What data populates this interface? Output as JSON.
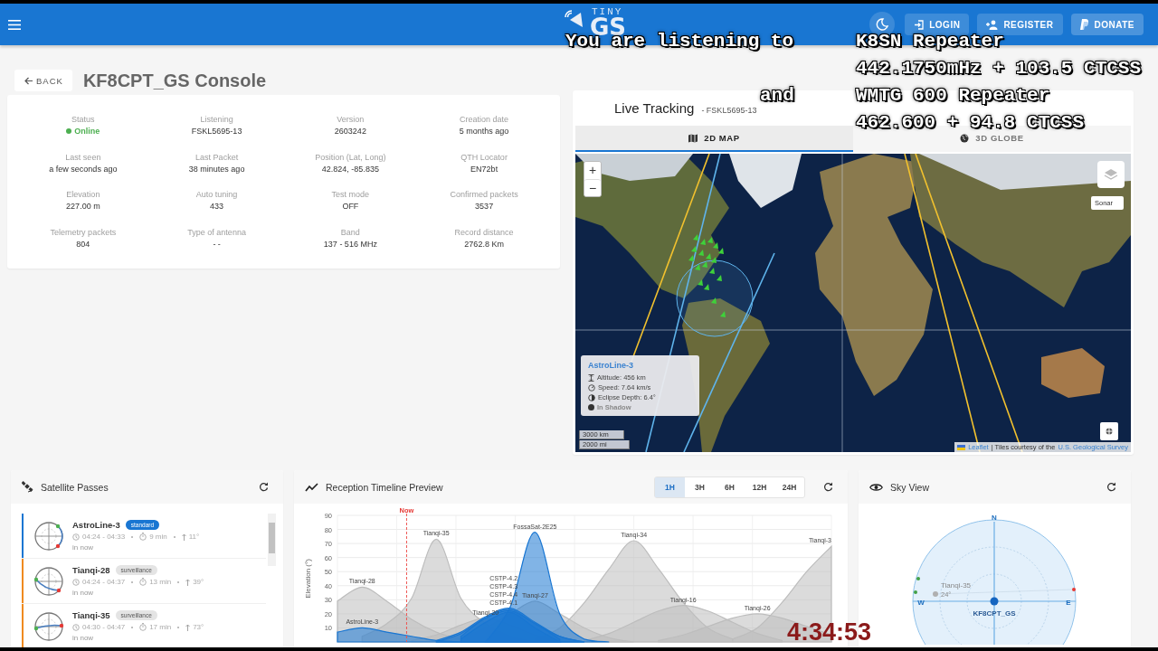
{
  "app_bar": {
    "logo_small": "TINY",
    "logo_large": "GS",
    "buttons": [
      {
        "label": "LOGIN",
        "kind": "login"
      },
      {
        "label": "REGISTER",
        "kind": "register"
      },
      {
        "label": "DONATE",
        "kind": "donate"
      }
    ]
  },
  "page": {
    "back": "BACK",
    "title": "KF8CPT_GS Console"
  },
  "station_info": [
    {
      "label": "Status",
      "value": "Online",
      "online": true
    },
    {
      "label": "Listening",
      "value": "FSKL5695-13"
    },
    {
      "label": "Version",
      "value": "2603242"
    },
    {
      "label": "Creation date",
      "value": "5 months ago"
    },
    {
      "label": "Last seen",
      "value": "a few seconds ago"
    },
    {
      "label": "Last Packet",
      "value": "38 minutes ago"
    },
    {
      "label": "Position (Lat, Long)",
      "value": "42.824, -85.835"
    },
    {
      "label": "QTH Locator",
      "value": "EN72bt"
    },
    {
      "label": "Elevation",
      "value": "227.00 m"
    },
    {
      "label": "Auto tuning",
      "value": "433"
    },
    {
      "label": "Test mode",
      "value": "OFF"
    },
    {
      "label": "Confirmed packets",
      "value": "3537"
    },
    {
      "label": "Telemetry packets",
      "value": "804"
    },
    {
      "label": "Type of antenna",
      "value": "- -"
    },
    {
      "label": "Band",
      "value": "137 - 516 MHz"
    },
    {
      "label": "Record distance",
      "value": "2762.8 Km"
    }
  ],
  "live_tracking": {
    "title": "Live Tracking",
    "subtitle": "- FSKL5695-13",
    "tabs": [
      {
        "label": "2D MAP",
        "selected": true,
        "kind": "map"
      },
      {
        "label": "3D GLOBE",
        "selected": false,
        "kind": "globe"
      }
    ],
    "map": {
      "zoom_in": "+",
      "zoom_out": "−",
      "layer_label": "Sonar",
      "popup": {
        "name": "AstroLine-3",
        "rows": [
          {
            "kind": "altitude",
            "text": "Altitude: 456 km"
          },
          {
            "kind": "speed",
            "text": "Speed: 7.64 km/s"
          },
          {
            "kind": "eclipse",
            "text": "Eclipse Depth: 6.4°"
          },
          {
            "kind": "shadow",
            "text": "In Shadow"
          }
        ]
      },
      "scale": [
        "3000 km",
        "2000 mi"
      ],
      "attribution": {
        "link": "Leaflet",
        "text": "| Tiles courtesy of the",
        "source": "U.S. Geological Survey"
      }
    }
  },
  "satellite_passes": {
    "title": "Satellite Passes",
    "items": [
      {
        "name": "AstroLine-3",
        "tag": "standard",
        "kind": "standard",
        "color": "#1976d2",
        "time": "04:24 - 04:33",
        "duration": "9 min",
        "max_elevation": "11°",
        "status": "in now"
      },
      {
        "name": "Tianqi-28",
        "tag": "surveillance",
        "kind": "surveillance",
        "color": "#ef8a1f",
        "time": "04:24 - 04:37",
        "duration": "13 min",
        "max_elevation": "39°",
        "status": "in now"
      },
      {
        "name": "Tianqi-35",
        "tag": "surveillance",
        "kind": "surveillance",
        "color": "#ef8a1f",
        "time": "04:30 - 04:47",
        "duration": "17 min",
        "max_elevation": "73°",
        "status": "in now"
      }
    ]
  },
  "timeline": {
    "title": "Reception Timeline Preview",
    "ranges": [
      {
        "label": "1H",
        "selected": true
      },
      {
        "label": "3H",
        "selected": false
      },
      {
        "label": "6H",
        "selected": false
      },
      {
        "label": "12H",
        "selected": false
      },
      {
        "label": "24H",
        "selected": false
      }
    ],
    "now_label": "Now",
    "chart": {
      "ylabel": "Elevation (°)",
      "yticks": [
        "90",
        "80",
        "70",
        "60",
        "50",
        "40",
        "30",
        "20",
        "10"
      ],
      "pass_labels": [
        "Tianqi-28",
        "Tianqi-35",
        "Tianqi-20",
        "Tianqi-27",
        "Tianqi-34",
        "Tianqi-16",
        "Tianqi-26",
        "Tianqi-3",
        "AstroLine-3",
        "CSTP-4.2",
        "CSTP-4.3",
        "CSTP-4.4",
        "CSTP-4.1",
        "FossaSat-2E25"
      ]
    }
  },
  "sky_view": {
    "title": "Sky View",
    "north": "N",
    "east": "E",
    "west": "W",
    "station": "KF8CPT_GS",
    "satellite": {
      "name": "Tianqi-35",
      "elevation": "24°"
    }
  },
  "stream_overlay": {
    "left": [
      "You are listening to",
      "and"
    ],
    "right": [
      "K8SN Repeater",
      "442.1750mHz + 103.5 CTCSS",
      "WMTG 600 Repeater",
      "462.600 + 94.8 CTCSS"
    ],
    "clock": "4:34:53"
  }
}
